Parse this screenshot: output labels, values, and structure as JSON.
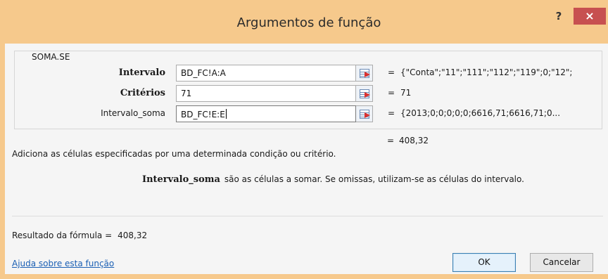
{
  "window": {
    "title": "Argumentos de função",
    "help_glyph": "?",
    "close_glyph": "×"
  },
  "function_group": {
    "name": "SOMA.SE"
  },
  "arguments": [
    {
      "label": "Intervalo",
      "value": "BD_FC!A:A",
      "equals": "=",
      "evaluated": "{\"Conta\";\"11\";\"111\";\"112\";\"119\";0;\"12\";"
    },
    {
      "label": "Critérios",
      "value": "71",
      "equals": "=",
      "evaluated": "71"
    },
    {
      "label": "Intervalo_soma",
      "value": "BD_FC!E:E",
      "equals": "=",
      "evaluated": "{2013;0;0;0;0;0;6616,71;6616,71;0..."
    }
  ],
  "result": {
    "equals": "=",
    "value": "408,32"
  },
  "description": "Adiciona as células especificadas por uma determinada condição ou critério.",
  "parameter_help": {
    "name": "Intervalo_soma",
    "text": "são as células a somar. Se omissas, utilizam-se as células do intervalo."
  },
  "formula_result": {
    "label": "Resultado da fórmula =",
    "value": "408,32"
  },
  "footer": {
    "help_link": "Ajuda sobre esta função",
    "ok_label": "OK",
    "cancel_label": "Cancelar"
  },
  "colors": {
    "titlebar": "#f6c98c",
    "close_button": "#c75050",
    "link": "#1a5fb4"
  },
  "icons": {
    "ref_button": "collapse-dialog-icon"
  }
}
